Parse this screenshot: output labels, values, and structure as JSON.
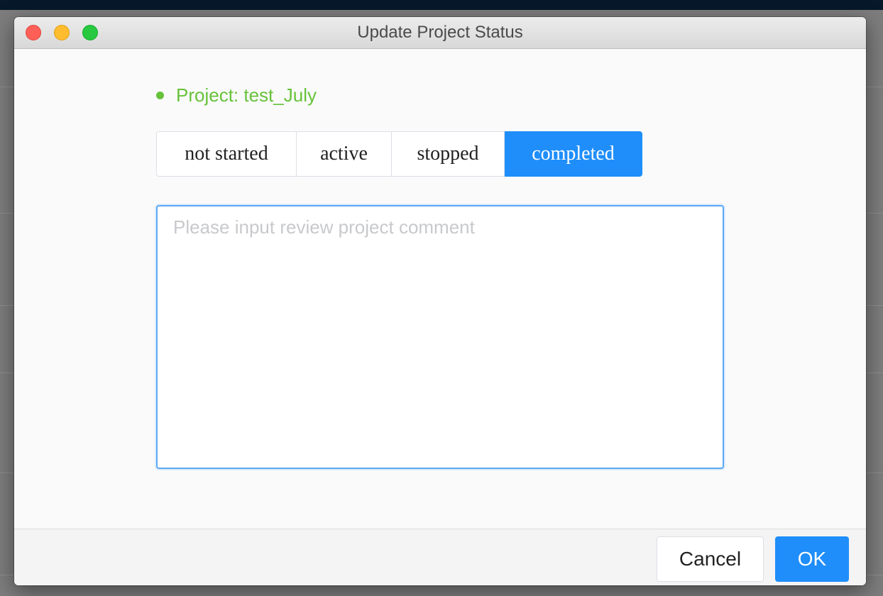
{
  "window": {
    "title": "Update Project Status"
  },
  "project": {
    "label": "Project: test_July",
    "color": "#67c23a"
  },
  "status_options": {
    "items": [
      {
        "label": "not started",
        "selected": false
      },
      {
        "label": "active",
        "selected": false
      },
      {
        "label": "stopped",
        "selected": false
      },
      {
        "label": "completed",
        "selected": true
      }
    ],
    "selected_color": "#1f8efa"
  },
  "comment": {
    "value": "",
    "placeholder": "Please input review project comment"
  },
  "footer": {
    "cancel_label": "Cancel",
    "ok_label": "OK"
  }
}
